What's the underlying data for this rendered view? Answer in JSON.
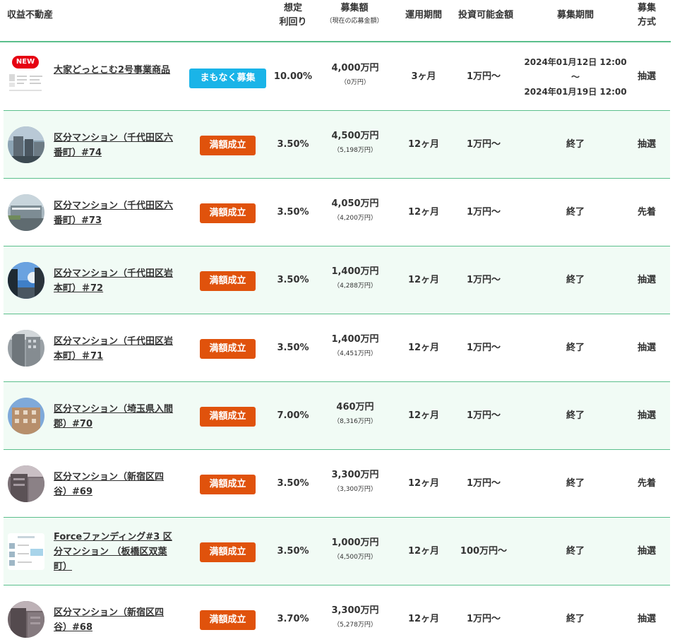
{
  "header": {
    "property": "収益不動産",
    "yield_l1": "想定",
    "yield_l2": "利回り",
    "amount": "募集額",
    "amount_sub": "（現在の応募金額）",
    "period": "運用期間",
    "minimum": "投資可能金額",
    "recruit": "募集期間",
    "method_l1": "募集",
    "method_l2": "方式"
  },
  "rows": [
    {
      "new_badge": "NEW",
      "name": "大家どっとこむ2号事業商品",
      "status": "まもなく募集",
      "yield": "10.00%",
      "amount": "4,000万円",
      "current": "（0万円）",
      "period": "3ヶ月",
      "minimum": "1万円〜",
      "recruit_start": "2024年01月12日 12:00",
      "recruit_sep": "〜",
      "recruit_end": "2024年01月19日 12:00",
      "method": "抽選"
    },
    {
      "name": "区分マンション（千代田区六番町）#74",
      "status": "満額成立",
      "yield": "3.50%",
      "amount": "4,500万円",
      "current": "（5,198万円）",
      "period": "12ヶ月",
      "minimum": "1万円〜",
      "recruit": "終了",
      "method": "抽選"
    },
    {
      "name": "区分マンション（千代田区六番町）#73",
      "status": "満額成立",
      "yield": "3.50%",
      "amount": "4,050万円",
      "current": "（4,200万円）",
      "period": "12ヶ月",
      "minimum": "1万円〜",
      "recruit": "終了",
      "method": "先着"
    },
    {
      "name": "区分マンション（千代田区岩本町）＃72",
      "status": "満額成立",
      "yield": "3.50%",
      "amount": "1,400万円",
      "current": "（4,288万円）",
      "period": "12ヶ月",
      "minimum": "1万円〜",
      "recruit": "終了",
      "method": "抽選"
    },
    {
      "name": "区分マンション（千代田区岩本町）＃71",
      "status": "満額成立",
      "yield": "3.50%",
      "amount": "1,400万円",
      "current": "（4,451万円）",
      "period": "12ヶ月",
      "minimum": "1万円〜",
      "recruit": "終了",
      "method": "抽選"
    },
    {
      "name": "区分マンション（埼玉県入間郡）#70",
      "status": "満額成立",
      "yield": "7.00%",
      "amount": "460万円",
      "current": "（8,316万円）",
      "period": "12ヶ月",
      "minimum": "1万円〜",
      "recruit": "終了",
      "method": "抽選"
    },
    {
      "name": "区分マンション（新宿区四谷）#69",
      "status": "満額成立",
      "yield": "3.50%",
      "amount": "3,300万円",
      "current": "（3,300万円）",
      "period": "12ヶ月",
      "minimum": "1万円〜",
      "recruit": "終了",
      "method": "先着"
    },
    {
      "name": "Forceファンディング#3 区分マンション （板橋区双葉町）",
      "status": "満額成立",
      "yield": "3.50%",
      "amount": "1,000万円",
      "current": "（4,500万円）",
      "period": "12ヶ月",
      "minimum": "100万円〜",
      "recruit": "終了",
      "method": "抽選"
    },
    {
      "name": "区分マンション（新宿区四谷）#68",
      "status": "満額成立",
      "yield": "3.70%",
      "amount": "3,300万円",
      "current": "（5,278万円）",
      "period": "12ヶ月",
      "minimum": "1万円〜",
      "recruit": "終了",
      "method": "抽選"
    }
  ]
}
